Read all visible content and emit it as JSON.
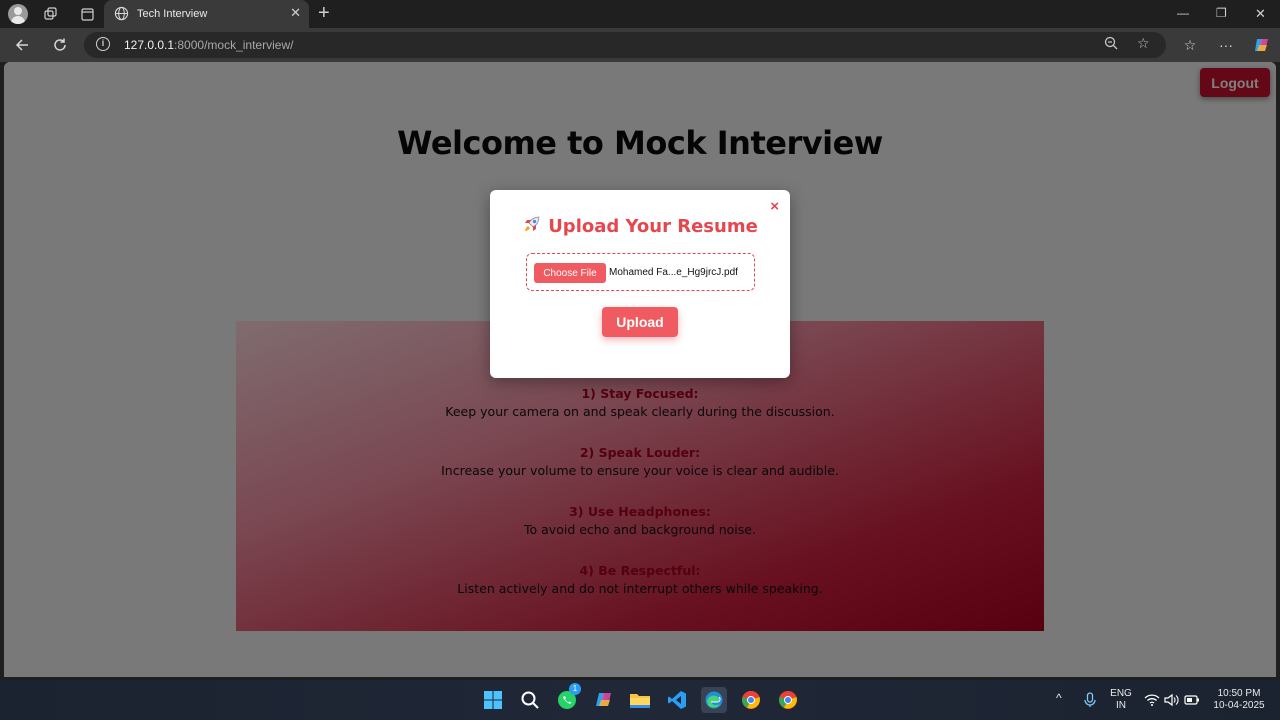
{
  "browser": {
    "tab_title": "Tech Interview",
    "url_host": "127.0.0.1",
    "url_rest": ":8000/mock_interview/"
  },
  "page": {
    "logout_label": "Logout",
    "title": "Welcome to Mock Interview",
    "guidelines": [
      {
        "heading": "1) Stay Focused:",
        "text": "Keep your camera on and speak clearly during the discussion."
      },
      {
        "heading": "2) Speak Louder:",
        "text": "Increase your volume to ensure your voice is clear and audible."
      },
      {
        "heading": "3) Use Headphones:",
        "text": "To avoid echo and background noise."
      },
      {
        "heading": "4) Be Respectful:",
        "text": "Listen actively and do not interrupt others while speaking."
      }
    ]
  },
  "modal": {
    "close_label": "×",
    "title": "Upload Your Resume",
    "choose_file_label": "Choose File",
    "file_name": "Mohamed Fa...e_Hg9jrcJ.pdf",
    "upload_label": "Upload"
  },
  "taskbar": {
    "whatsapp_badge": "1",
    "lang_line1": "ENG",
    "lang_line2": "IN",
    "time": "10:50 PM",
    "date": "10-04-2025"
  },
  "colors": {
    "accent": "#f05a61",
    "logout": "#c8102e",
    "heading_red": "#a8001e"
  }
}
